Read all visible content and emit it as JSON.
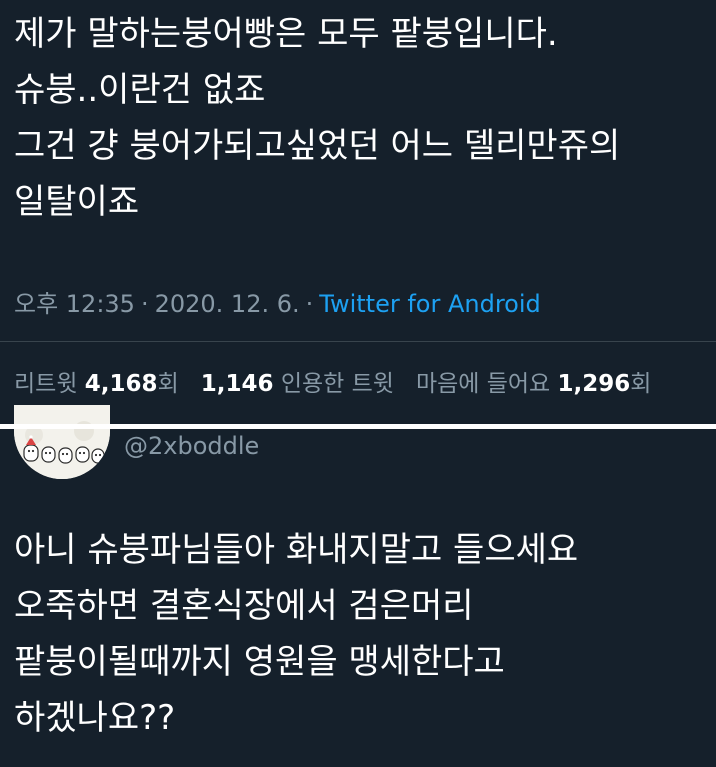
{
  "tweet": {
    "lines": [
      "제가 말하는붕어빵은 모두 팥붕입니다.",
      "슈붕..이란건 없죠",
      "그건 걍 붕어가되고싶었던 어느 델리만쥬의",
      "일탈이죠"
    ],
    "time": "오후 12:35",
    "separator": "·",
    "date": "2020. 12. 6.",
    "source": "Twitter for Android",
    "stats": {
      "retweets_label": "리트윗",
      "retweets": "4,168",
      "retweets_suffix": "회",
      "quotes": "1,146",
      "quotes_label": "인용한 트윗",
      "likes_label": "마음에 들어요",
      "likes": "1,296",
      "likes_suffix": "회"
    }
  },
  "reply": {
    "handle": "@2xboddle",
    "avatar_icon": "cartoon-avatar-icon",
    "lines": [
      "아니 슈붕파님들아 화내지말고 들으세요",
      "오죽하면 결혼식장에서 검은머리",
      "팥붕이될때까지 영원을 맹세한다고",
      "하겠나요??"
    ]
  },
  "colors": {
    "background": "#15202b",
    "text": "#ffffff",
    "muted": "#8899a6",
    "link": "#1da1f2",
    "divider": "#38444d"
  }
}
